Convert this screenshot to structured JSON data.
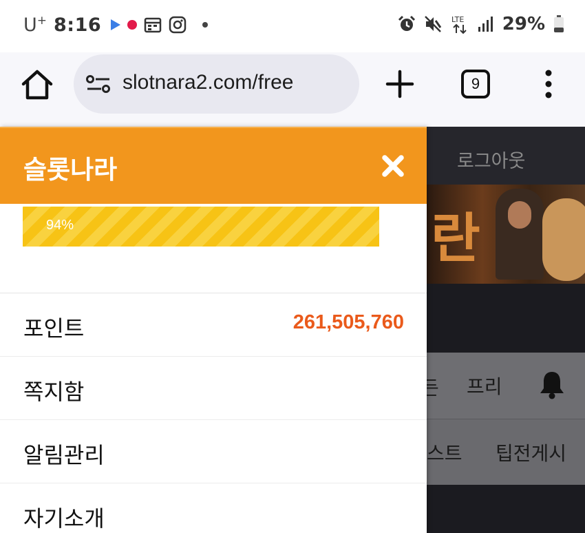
{
  "status_bar": {
    "carrier": "U",
    "carrier_sup": "+",
    "time": "8:16",
    "battery": "29%",
    "network": "LTE",
    "icons": [
      "play-icon",
      "record-dot-icon",
      "calendar-icon",
      "instagram-icon",
      "dot-icon",
      "alarm-icon",
      "mute-icon",
      "lte-icon",
      "signal-icon",
      "battery-icon"
    ]
  },
  "browser": {
    "url": "slotnara2.com/free",
    "tab_count": "9"
  },
  "drawer": {
    "title": "슬롯나라",
    "progress": {
      "percent": 94,
      "label": "94%"
    },
    "menu": [
      {
        "label": "포인트",
        "value": "261,505,760"
      },
      {
        "label": "쪽지함"
      },
      {
        "label": "알림관리"
      },
      {
        "label": "자기소개"
      }
    ]
  },
  "background_page": {
    "logout": "로그아웃",
    "banner_text": "란",
    "nav_row1": [
      "든",
      "프리"
    ],
    "nav_row2": [
      "스트",
      "팁전게시"
    ]
  },
  "colors": {
    "header_orange": "#f2961d",
    "progress_yellow": "#f7c315",
    "points_orange": "#ea5a1b"
  }
}
